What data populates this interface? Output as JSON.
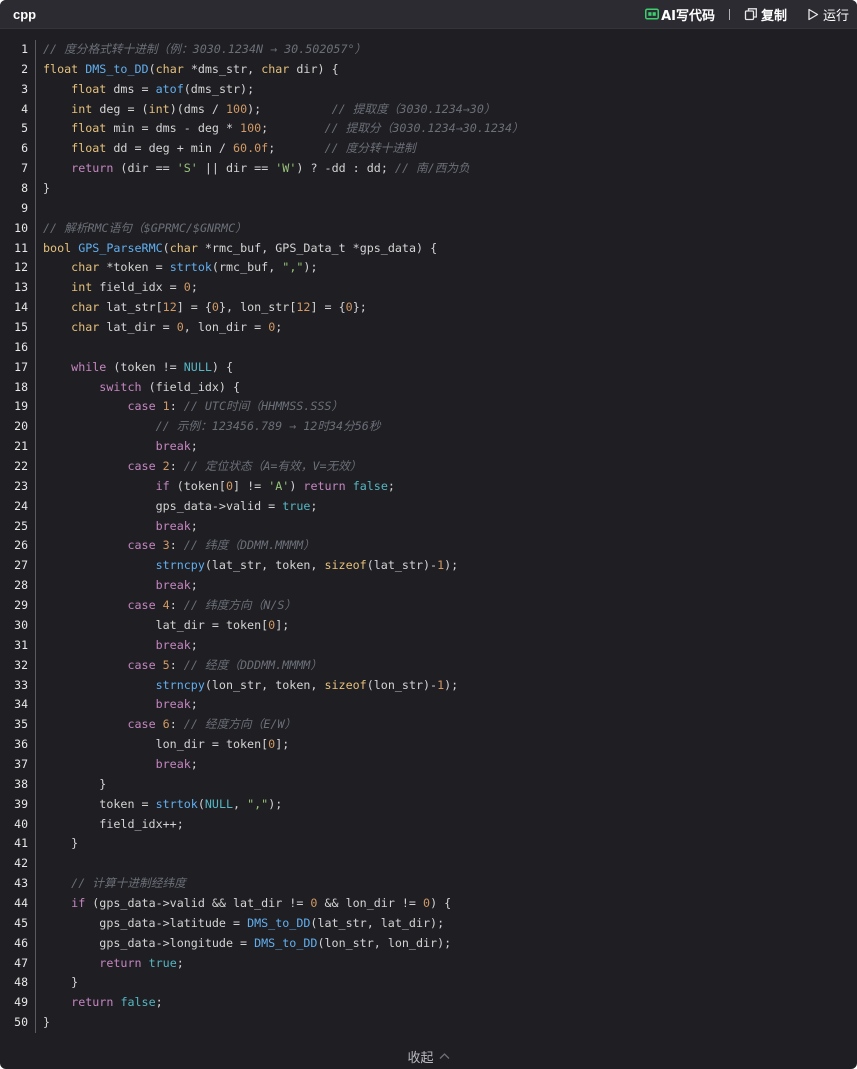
{
  "header": {
    "language": "cpp",
    "ai_label": "AI写代码",
    "copy_label": "复制",
    "run_label": "运行",
    "icons": [
      "ai-icon",
      "copy-icon",
      "play-icon"
    ]
  },
  "footer": {
    "collapse_label": "收起",
    "icon": "chevron-up-icon"
  },
  "colors": {
    "background": "#1e1e23",
    "keyword": "#c586c0",
    "type": "#e5c07b",
    "function": "#61afef",
    "number": "#d19a66",
    "string": "#98c379",
    "comment": "#6b6f78",
    "ai_icon": "#3ccf6f"
  },
  "code": {
    "lines": [
      {
        "n": "1",
        "tokens": [
          [
            "cm",
            "// 度分格式转十进制（例：3030.1234N → 30.502057°）"
          ]
        ]
      },
      {
        "n": "2",
        "tokens": [
          [
            "type",
            "float"
          ],
          [
            "op",
            " "
          ],
          [
            "fn",
            "DMS_to_DD"
          ],
          [
            "op",
            "("
          ],
          [
            "type",
            "char"
          ],
          [
            "op",
            " *dms_str, "
          ],
          [
            "type",
            "char"
          ],
          [
            "op",
            " dir) {"
          ]
        ]
      },
      {
        "n": "3",
        "tokens": [
          [
            "op",
            "    "
          ],
          [
            "type",
            "float"
          ],
          [
            "op",
            " dms = "
          ],
          [
            "fn",
            "atof"
          ],
          [
            "op",
            "(dms_str);"
          ]
        ]
      },
      {
        "n": "4",
        "tokens": [
          [
            "op",
            "    "
          ],
          [
            "type",
            "int"
          ],
          [
            "op",
            " deg = ("
          ],
          [
            "type",
            "int"
          ],
          [
            "op",
            ")(dms / "
          ],
          [
            "num",
            "100"
          ],
          [
            "op",
            ");          "
          ],
          [
            "cm",
            "// 提取度（3030.1234→30）"
          ]
        ]
      },
      {
        "n": "5",
        "tokens": [
          [
            "op",
            "    "
          ],
          [
            "type",
            "float"
          ],
          [
            "op",
            " min = dms - deg * "
          ],
          [
            "num",
            "100"
          ],
          [
            "op",
            ";        "
          ],
          [
            "cm",
            "// 提取分（3030.1234→30.1234）"
          ]
        ]
      },
      {
        "n": "6",
        "tokens": [
          [
            "op",
            "    "
          ],
          [
            "type",
            "float"
          ],
          [
            "op",
            " dd = deg + min / "
          ],
          [
            "num",
            "60.0f"
          ],
          [
            "op",
            ";       "
          ],
          [
            "cm",
            "// 度分转十进制"
          ]
        ]
      },
      {
        "n": "7",
        "tokens": [
          [
            "op",
            "    "
          ],
          [
            "kw",
            "return"
          ],
          [
            "op",
            " (dir == "
          ],
          [
            "str",
            "'S'"
          ],
          [
            "op",
            " || dir == "
          ],
          [
            "str",
            "'W'"
          ],
          [
            "op",
            ") ? -dd : dd; "
          ],
          [
            "cm",
            "// 南/西为负"
          ]
        ]
      },
      {
        "n": "8",
        "tokens": [
          [
            "op",
            "}"
          ]
        ]
      },
      {
        "n": "9",
        "tokens": []
      },
      {
        "n": "10",
        "tokens": [
          [
            "cm",
            "// 解析RMC语句（$GPRMC/$GNRMC）"
          ]
        ]
      },
      {
        "n": "11",
        "tokens": [
          [
            "type",
            "bool"
          ],
          [
            "op",
            " "
          ],
          [
            "fn",
            "GPS_ParseRMC"
          ],
          [
            "op",
            "("
          ],
          [
            "type",
            "char"
          ],
          [
            "op",
            " *rmc_buf, GPS_Data_t *gps_data) {"
          ]
        ]
      },
      {
        "n": "12",
        "tokens": [
          [
            "op",
            "    "
          ],
          [
            "type",
            "char"
          ],
          [
            "op",
            " *token = "
          ],
          [
            "fn",
            "strtok"
          ],
          [
            "op",
            "(rmc_buf, "
          ],
          [
            "str",
            "\",\""
          ],
          [
            "op",
            ");"
          ]
        ]
      },
      {
        "n": "13",
        "tokens": [
          [
            "op",
            "    "
          ],
          [
            "type",
            "int"
          ],
          [
            "op",
            " field_idx = "
          ],
          [
            "num",
            "0"
          ],
          [
            "op",
            ";"
          ]
        ]
      },
      {
        "n": "14",
        "tokens": [
          [
            "op",
            "    "
          ],
          [
            "type",
            "char"
          ],
          [
            "op",
            " lat_str["
          ],
          [
            "num",
            "12"
          ],
          [
            "op",
            "] = {"
          ],
          [
            "num",
            "0"
          ],
          [
            "op",
            "}, lon_str["
          ],
          [
            "num",
            "12"
          ],
          [
            "op",
            "] = {"
          ],
          [
            "num",
            "0"
          ],
          [
            "op",
            "};"
          ]
        ]
      },
      {
        "n": "15",
        "tokens": [
          [
            "op",
            "    "
          ],
          [
            "type",
            "char"
          ],
          [
            "op",
            " lat_dir = "
          ],
          [
            "num",
            "0"
          ],
          [
            "op",
            ", lon_dir = "
          ],
          [
            "num",
            "0"
          ],
          [
            "op",
            ";"
          ]
        ]
      },
      {
        "n": "16",
        "tokens": []
      },
      {
        "n": "17",
        "tokens": [
          [
            "op",
            "    "
          ],
          [
            "kw",
            "while"
          ],
          [
            "op",
            " (token != "
          ],
          [
            "lit",
            "NULL"
          ],
          [
            "op",
            ") {"
          ]
        ]
      },
      {
        "n": "18",
        "tokens": [
          [
            "op",
            "        "
          ],
          [
            "kw",
            "switch"
          ],
          [
            "op",
            " (field_idx) {"
          ]
        ]
      },
      {
        "n": "19",
        "tokens": [
          [
            "op",
            "            "
          ],
          [
            "kw",
            "case"
          ],
          [
            "op",
            " "
          ],
          [
            "num",
            "1"
          ],
          [
            "op",
            ": "
          ],
          [
            "cm",
            "// UTC时间（HHMMSS.SSS）"
          ]
        ]
      },
      {
        "n": "20",
        "tokens": [
          [
            "op",
            "                "
          ],
          [
            "cm",
            "// 示例：123456.789 → 12时34分56秒"
          ]
        ]
      },
      {
        "n": "21",
        "tokens": [
          [
            "op",
            "                "
          ],
          [
            "kw",
            "break"
          ],
          [
            "op",
            ";"
          ]
        ]
      },
      {
        "n": "22",
        "tokens": [
          [
            "op",
            "            "
          ],
          [
            "kw",
            "case"
          ],
          [
            "op",
            " "
          ],
          [
            "num",
            "2"
          ],
          [
            "op",
            ": "
          ],
          [
            "cm",
            "// 定位状态（A=有效，V=无效）"
          ]
        ]
      },
      {
        "n": "23",
        "tokens": [
          [
            "op",
            "                "
          ],
          [
            "kw",
            "if"
          ],
          [
            "op",
            " (token["
          ],
          [
            "num",
            "0"
          ],
          [
            "op",
            "] != "
          ],
          [
            "str",
            "'A'"
          ],
          [
            "op",
            ") "
          ],
          [
            "kw",
            "return"
          ],
          [
            "op",
            " "
          ],
          [
            "lit",
            "false"
          ],
          [
            "op",
            ";"
          ]
        ]
      },
      {
        "n": "24",
        "tokens": [
          [
            "op",
            "                gps_data->valid = "
          ],
          [
            "lit",
            "true"
          ],
          [
            "op",
            ";"
          ]
        ]
      },
      {
        "n": "25",
        "tokens": [
          [
            "op",
            "                "
          ],
          [
            "kw",
            "break"
          ],
          [
            "op",
            ";"
          ]
        ]
      },
      {
        "n": "26",
        "tokens": [
          [
            "op",
            "            "
          ],
          [
            "kw",
            "case"
          ],
          [
            "op",
            " "
          ],
          [
            "num",
            "3"
          ],
          [
            "op",
            ": "
          ],
          [
            "cm",
            "// 纬度（DDMM.MMMM）"
          ]
        ]
      },
      {
        "n": "27",
        "tokens": [
          [
            "op",
            "                "
          ],
          [
            "fn",
            "strncpy"
          ],
          [
            "op",
            "(lat_str, token, "
          ],
          [
            "type",
            "sizeof"
          ],
          [
            "op",
            "(lat_str)-"
          ],
          [
            "num",
            "1"
          ],
          [
            "op",
            ");"
          ]
        ]
      },
      {
        "n": "28",
        "tokens": [
          [
            "op",
            "                "
          ],
          [
            "kw",
            "break"
          ],
          [
            "op",
            ";"
          ]
        ]
      },
      {
        "n": "29",
        "tokens": [
          [
            "op",
            "            "
          ],
          [
            "kw",
            "case"
          ],
          [
            "op",
            " "
          ],
          [
            "num",
            "4"
          ],
          [
            "op",
            ": "
          ],
          [
            "cm",
            "// 纬度方向（N/S）"
          ]
        ]
      },
      {
        "n": "30",
        "tokens": [
          [
            "op",
            "                lat_dir = token["
          ],
          [
            "num",
            "0"
          ],
          [
            "op",
            "];"
          ]
        ]
      },
      {
        "n": "31",
        "tokens": [
          [
            "op",
            "                "
          ],
          [
            "kw",
            "break"
          ],
          [
            "op",
            ";"
          ]
        ]
      },
      {
        "n": "32",
        "tokens": [
          [
            "op",
            "            "
          ],
          [
            "kw",
            "case"
          ],
          [
            "op",
            " "
          ],
          [
            "num",
            "5"
          ],
          [
            "op",
            ": "
          ],
          [
            "cm",
            "// 经度（DDDMM.MMMM）"
          ]
        ]
      },
      {
        "n": "33",
        "tokens": [
          [
            "op",
            "                "
          ],
          [
            "fn",
            "strncpy"
          ],
          [
            "op",
            "(lon_str, token, "
          ],
          [
            "type",
            "sizeof"
          ],
          [
            "op",
            "(lon_str)-"
          ],
          [
            "num",
            "1"
          ],
          [
            "op",
            ");"
          ]
        ]
      },
      {
        "n": "34",
        "tokens": [
          [
            "op",
            "                "
          ],
          [
            "kw",
            "break"
          ],
          [
            "op",
            ";"
          ]
        ]
      },
      {
        "n": "35",
        "tokens": [
          [
            "op",
            "            "
          ],
          [
            "kw",
            "case"
          ],
          [
            "op",
            " "
          ],
          [
            "num",
            "6"
          ],
          [
            "op",
            ": "
          ],
          [
            "cm",
            "// 经度方向（E/W）"
          ]
        ]
      },
      {
        "n": "36",
        "tokens": [
          [
            "op",
            "                lon_dir = token["
          ],
          [
            "num",
            "0"
          ],
          [
            "op",
            "];"
          ]
        ]
      },
      {
        "n": "37",
        "tokens": [
          [
            "op",
            "                "
          ],
          [
            "kw",
            "break"
          ],
          [
            "op",
            ";"
          ]
        ]
      },
      {
        "n": "38",
        "tokens": [
          [
            "op",
            "        }"
          ]
        ]
      },
      {
        "n": "39",
        "tokens": [
          [
            "op",
            "        token = "
          ],
          [
            "fn",
            "strtok"
          ],
          [
            "op",
            "("
          ],
          [
            "lit",
            "NULL"
          ],
          [
            "op",
            ", "
          ],
          [
            "str",
            "\",\""
          ],
          [
            "op",
            ");"
          ]
        ]
      },
      {
        "n": "40",
        "tokens": [
          [
            "op",
            "        field_idx++;"
          ]
        ]
      },
      {
        "n": "41",
        "tokens": [
          [
            "op",
            "    }"
          ]
        ]
      },
      {
        "n": "42",
        "tokens": []
      },
      {
        "n": "43",
        "tokens": [
          [
            "op",
            "    "
          ],
          [
            "cm",
            "// 计算十进制经纬度"
          ]
        ]
      },
      {
        "n": "44",
        "tokens": [
          [
            "op",
            "    "
          ],
          [
            "kw",
            "if"
          ],
          [
            "op",
            " (gps_data->valid && lat_dir != "
          ],
          [
            "num",
            "0"
          ],
          [
            "op",
            " && lon_dir != "
          ],
          [
            "num",
            "0"
          ],
          [
            "op",
            ") {"
          ]
        ]
      },
      {
        "n": "45",
        "tokens": [
          [
            "op",
            "        gps_data->latitude = "
          ],
          [
            "fn",
            "DMS_to_DD"
          ],
          [
            "op",
            "(lat_str, lat_dir);"
          ]
        ]
      },
      {
        "n": "46",
        "tokens": [
          [
            "op",
            "        gps_data->longitude = "
          ],
          [
            "fn",
            "DMS_to_DD"
          ],
          [
            "op",
            "(lon_str, lon_dir);"
          ]
        ]
      },
      {
        "n": "47",
        "tokens": [
          [
            "op",
            "        "
          ],
          [
            "kw",
            "return"
          ],
          [
            "op",
            " "
          ],
          [
            "lit",
            "true"
          ],
          [
            "op",
            ";"
          ]
        ]
      },
      {
        "n": "48",
        "tokens": [
          [
            "op",
            "    }"
          ]
        ]
      },
      {
        "n": "49",
        "tokens": [
          [
            "op",
            "    "
          ],
          [
            "kw",
            "return"
          ],
          [
            "op",
            " "
          ],
          [
            "lit",
            "false"
          ],
          [
            "op",
            ";"
          ]
        ]
      },
      {
        "n": "50",
        "tokens": [
          [
            "op",
            "}"
          ]
        ]
      }
    ]
  }
}
